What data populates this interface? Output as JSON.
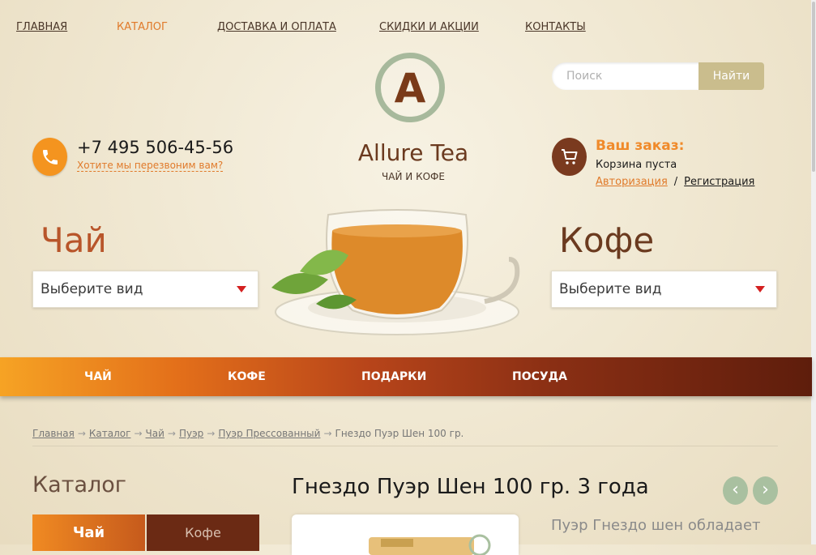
{
  "top_nav": [
    {
      "label": "ГЛАВНАЯ",
      "active": false
    },
    {
      "label": "КАТАЛОГ",
      "active": true
    },
    {
      "label": "ДОСТАВКА И ОПЛАТА",
      "active": false
    },
    {
      "label": "СКИДКИ И АКЦИИ",
      "active": false
    },
    {
      "label": "КОНТАКТЫ",
      "active": false
    }
  ],
  "search": {
    "placeholder": "Поиск",
    "button_label": "Найти"
  },
  "brand": {
    "logo_letter": "A",
    "name": "Allure Tea",
    "tagline": "ЧАЙ И КОФЕ"
  },
  "contact": {
    "phone": "+7 495 506-45-56",
    "callback_text": "Хотите мы перезвоним вам?"
  },
  "cart": {
    "title": "Ваш заказ:",
    "status": "Корзина пуста",
    "login_label": "Авторизация",
    "separator": "/",
    "register_label": "Регистрация"
  },
  "categories": {
    "tea": {
      "heading": "Чай",
      "select_value": "Выберите вид"
    },
    "coffee": {
      "heading": "Кофе",
      "select_value": "Выберите вид"
    }
  },
  "main_menu": [
    "ЧАЙ",
    "КОФЕ",
    "ПОДАРКИ",
    "ПОСУДА"
  ],
  "breadcrumb": {
    "links": [
      "Главная",
      "Каталог",
      "Чай",
      "Пуэр",
      "Пуэр Прессованный"
    ],
    "current": "Гнездо Пуэр Шен 100 гр.",
    "separator": "→"
  },
  "sidebar": {
    "title": "Каталог",
    "tabs": [
      "Чай",
      "Кофе"
    ]
  },
  "product": {
    "title": "Гнездо Пуэр Шен 100 гр. 3 года",
    "description_start": "Пуэр Гнездо шен обладает",
    "prev_label": "‹",
    "next_label": "›"
  },
  "colors": {
    "accent_orange": "#f08a2a",
    "brown": "#6b2a14",
    "sage": "#a9c0a0"
  }
}
